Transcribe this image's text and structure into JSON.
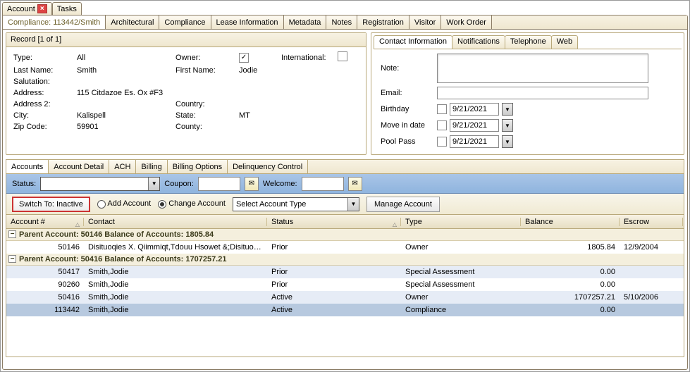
{
  "topTabs": {
    "account": "Account",
    "tasks": "Tasks"
  },
  "navTabs": {
    "active": "Compliance: 113442/Smith",
    "items": [
      "Architectural",
      "Compliance",
      "Lease Information",
      "Metadata",
      "Notes",
      "Registration",
      "Visitor",
      "Work Order"
    ]
  },
  "record": {
    "header": "Record [1 of 1]",
    "labels": {
      "type": "Type:",
      "owner": "Owner:",
      "intl": "International:",
      "lastName": "Last Name:",
      "firstName": "First Name:",
      "salutation": "Salutation:",
      "address": "Address:",
      "address2": "Address 2:",
      "country": "Country:",
      "city": "City:",
      "state": "State:",
      "zip": "Zip Code:",
      "county": "County:"
    },
    "values": {
      "type": "All",
      "lastName": "Smith",
      "firstName": "Jodie",
      "address": "115 Citdazoe Es. Ox #F3",
      "city": "Kalispell",
      "state": "MT",
      "zip": "59901"
    }
  },
  "contact": {
    "tabs": [
      "Contact Information",
      "Notifications",
      "Telephone",
      "Web"
    ],
    "labels": {
      "note": "Note:",
      "email": "Email:",
      "birthday": "Birthday",
      "movein": "Move in date",
      "pool": "Pool Pass"
    },
    "dates": {
      "birthday": "9/21/2021",
      "movein": "9/21/2021",
      "pool": "9/21/2021"
    }
  },
  "lowerTabs": [
    "Accounts",
    "Account Detail",
    "ACH",
    "Billing",
    "Billing Options",
    "Delinquency Control"
  ],
  "statusBar": {
    "status": "Status:",
    "coupon": "Coupon:",
    "welcome": "Welcome:"
  },
  "actionBar": {
    "switch": "Switch To: Inactive",
    "add": "Add Account",
    "change": "Change Account",
    "selectPlaceholder": "Select Account Type",
    "manage": "Manage Account"
  },
  "gridCols": {
    "acct": "Account #",
    "contact": "Contact",
    "status": "Status",
    "type": "Type",
    "balance": "Balance",
    "escrow": "Escrow"
  },
  "groups": [
    {
      "header": "Parent Account: 50146 Balance of Accounts: 1805.84",
      "rows": [
        {
          "acct": "50146",
          "contact": "Disituoqies X. Qiimmiqt,Tdouu Hsowet &;Disituoqi...",
          "status": "Prior",
          "type": "Owner",
          "balance": "1805.84",
          "escrow": "12/9/2004",
          "alt": false
        }
      ]
    },
    {
      "header": "Parent Account: 50416 Balance of Accounts: 1707257.21",
      "rows": [
        {
          "acct": "50417",
          "contact": "Smith,Jodie",
          "status": "Prior",
          "type": "Special Assessment",
          "balance": "0.00",
          "escrow": "",
          "alt": true
        },
        {
          "acct": "90260",
          "contact": "Smith,Jodie",
          "status": "Prior",
          "type": "Special Assessment",
          "balance": "0.00",
          "escrow": "",
          "alt": false
        },
        {
          "acct": "50416",
          "contact": "Smith,Jodie",
          "status": "Active",
          "type": "Owner",
          "balance": "1707257.21",
          "escrow": "5/10/2006",
          "alt": true
        },
        {
          "acct": "113442",
          "contact": "Smith,Jodie",
          "status": "Active",
          "type": "Compliance",
          "balance": "0.00",
          "escrow": "",
          "sel": true
        }
      ]
    }
  ]
}
